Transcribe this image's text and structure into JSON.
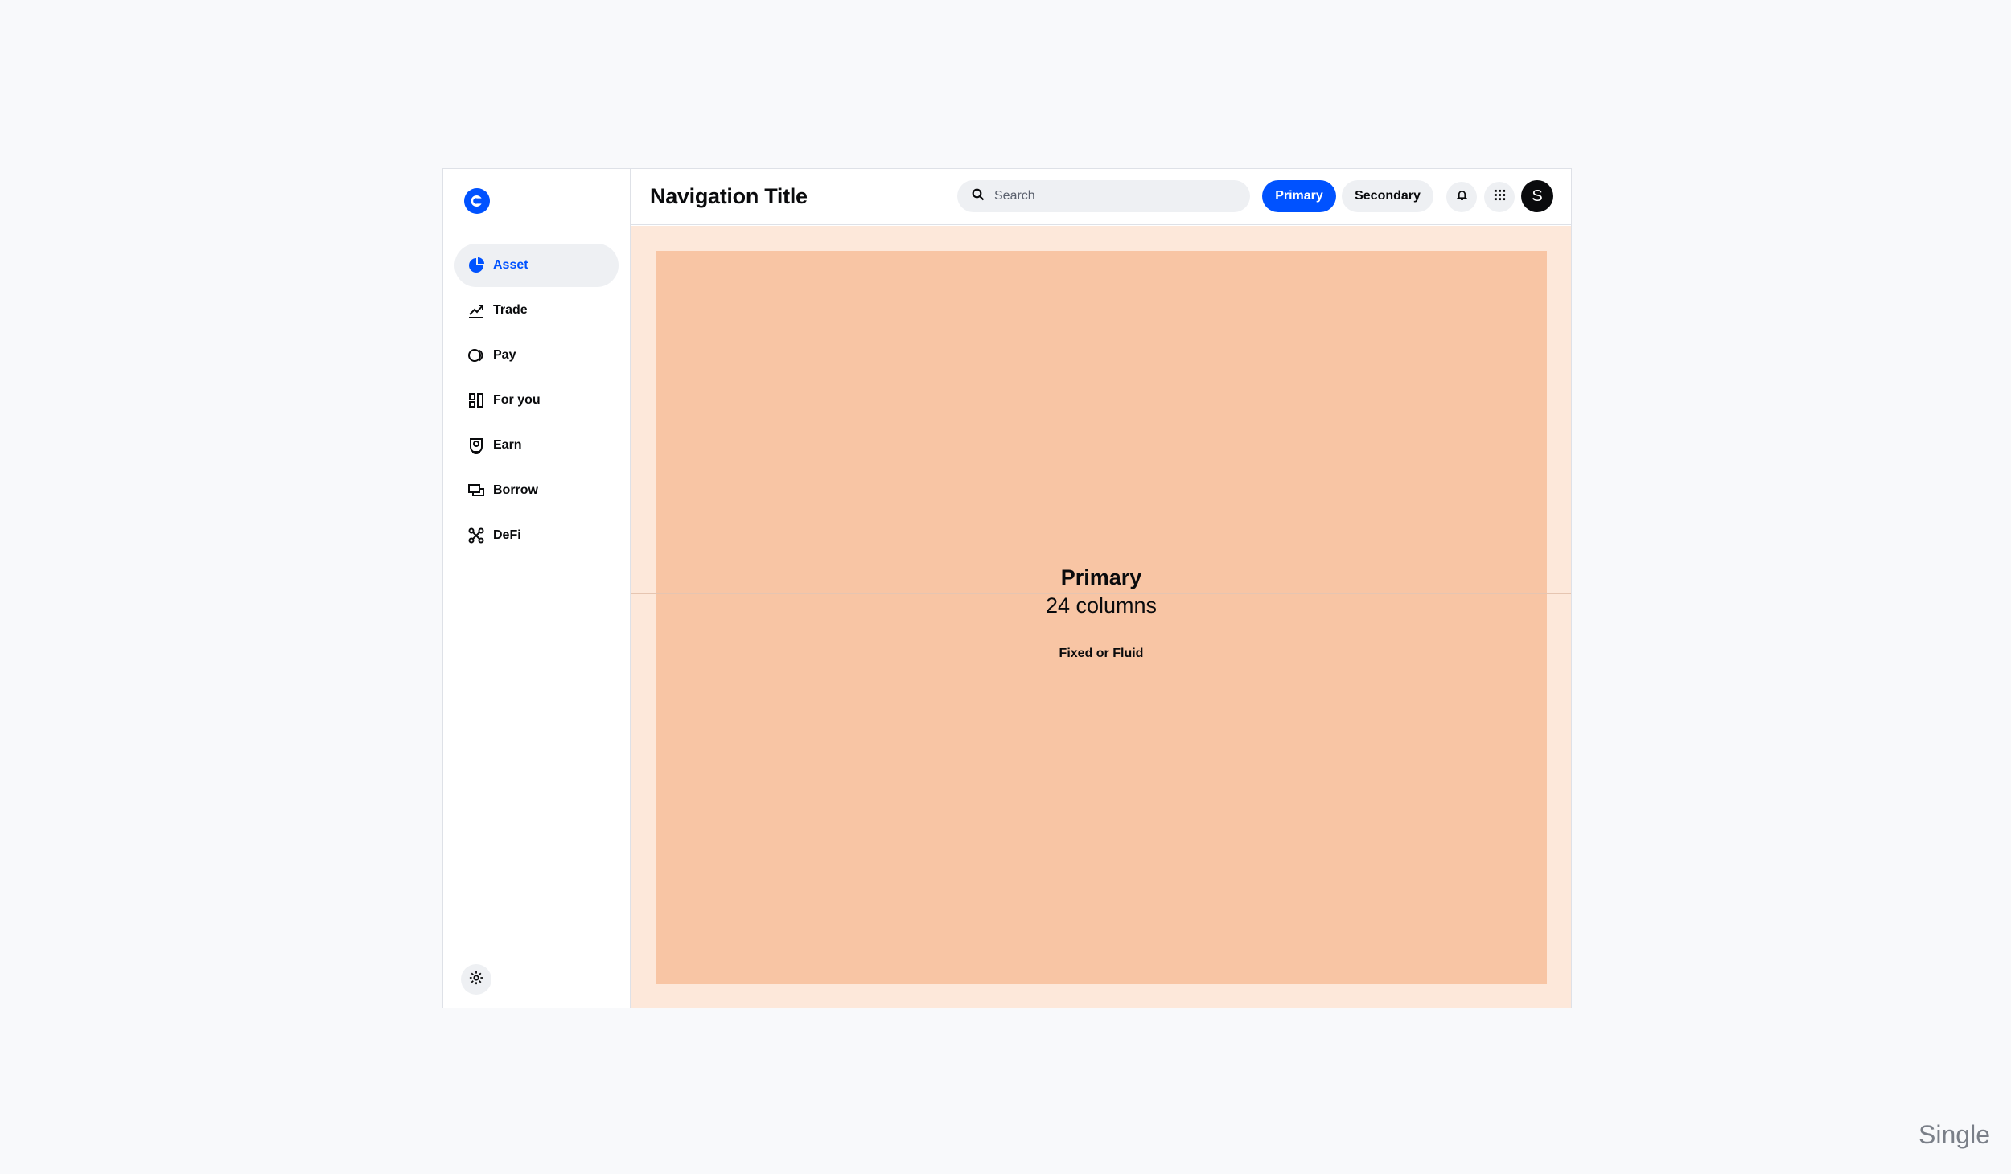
{
  "header": {
    "title": "Navigation Title",
    "search_placeholder": "Search",
    "primary_label": "Primary",
    "secondary_label": "Secondary",
    "avatar_initial": "S"
  },
  "sidebar": {
    "items": [
      {
        "label": "Asset",
        "icon": "pie-chart-icon",
        "active": true
      },
      {
        "label": "Trade",
        "icon": "trend-up-icon"
      },
      {
        "label": "Pay",
        "icon": "pay-icon"
      },
      {
        "label": "For you",
        "icon": "layout-icon"
      },
      {
        "label": "Earn",
        "icon": "earn-icon"
      },
      {
        "label": "Borrow",
        "icon": "borrow-icon"
      },
      {
        "label": "DeFi",
        "icon": "defi-icon"
      }
    ]
  },
  "content": {
    "region_title": "Primary",
    "region_subtitle": "24 columns",
    "region_note": "Fixed or Fluid"
  },
  "footer": {
    "corner_label": "Single"
  },
  "colors": {
    "brand": "#0052ff",
    "region_fill": "#f8c5a4",
    "region_margin": "#fde8da"
  }
}
